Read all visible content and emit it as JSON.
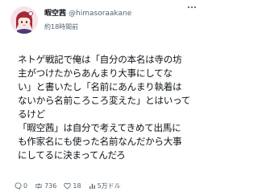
{
  "author": {
    "display_name": "暇空茜",
    "handle": "@himasoraakane"
  },
  "post": {
    "timestamp": "約18時間前",
    "lines": [
      "ネトゲ戦記で俺は「自分の本名は寺の坊",
      "主がつけたからあんまり大事にしてな",
      "い」と書いたし「名前にあんまり執着は",
      "ないから名前ころころ変えた」とはいって",
      "るけど",
      "「暇空茜」は自分で考えてきめて出馬に",
      "も作家名にも使った名前なんだから大事",
      "にしてるに決まってんだろ"
    ]
  },
  "actions": {
    "replies": "0",
    "reposts": "736",
    "likes": "18",
    "views": "5万ドル"
  },
  "colors": {
    "text": "#0f1419",
    "muted": "#536471",
    "avatar_bg": "#f6e3e7",
    "avatar_hair": "#a5283c"
  },
  "icons": [
    "avatar",
    "more-icon",
    "reply-icon",
    "repost-icon",
    "like-icon",
    "views-icon"
  ]
}
